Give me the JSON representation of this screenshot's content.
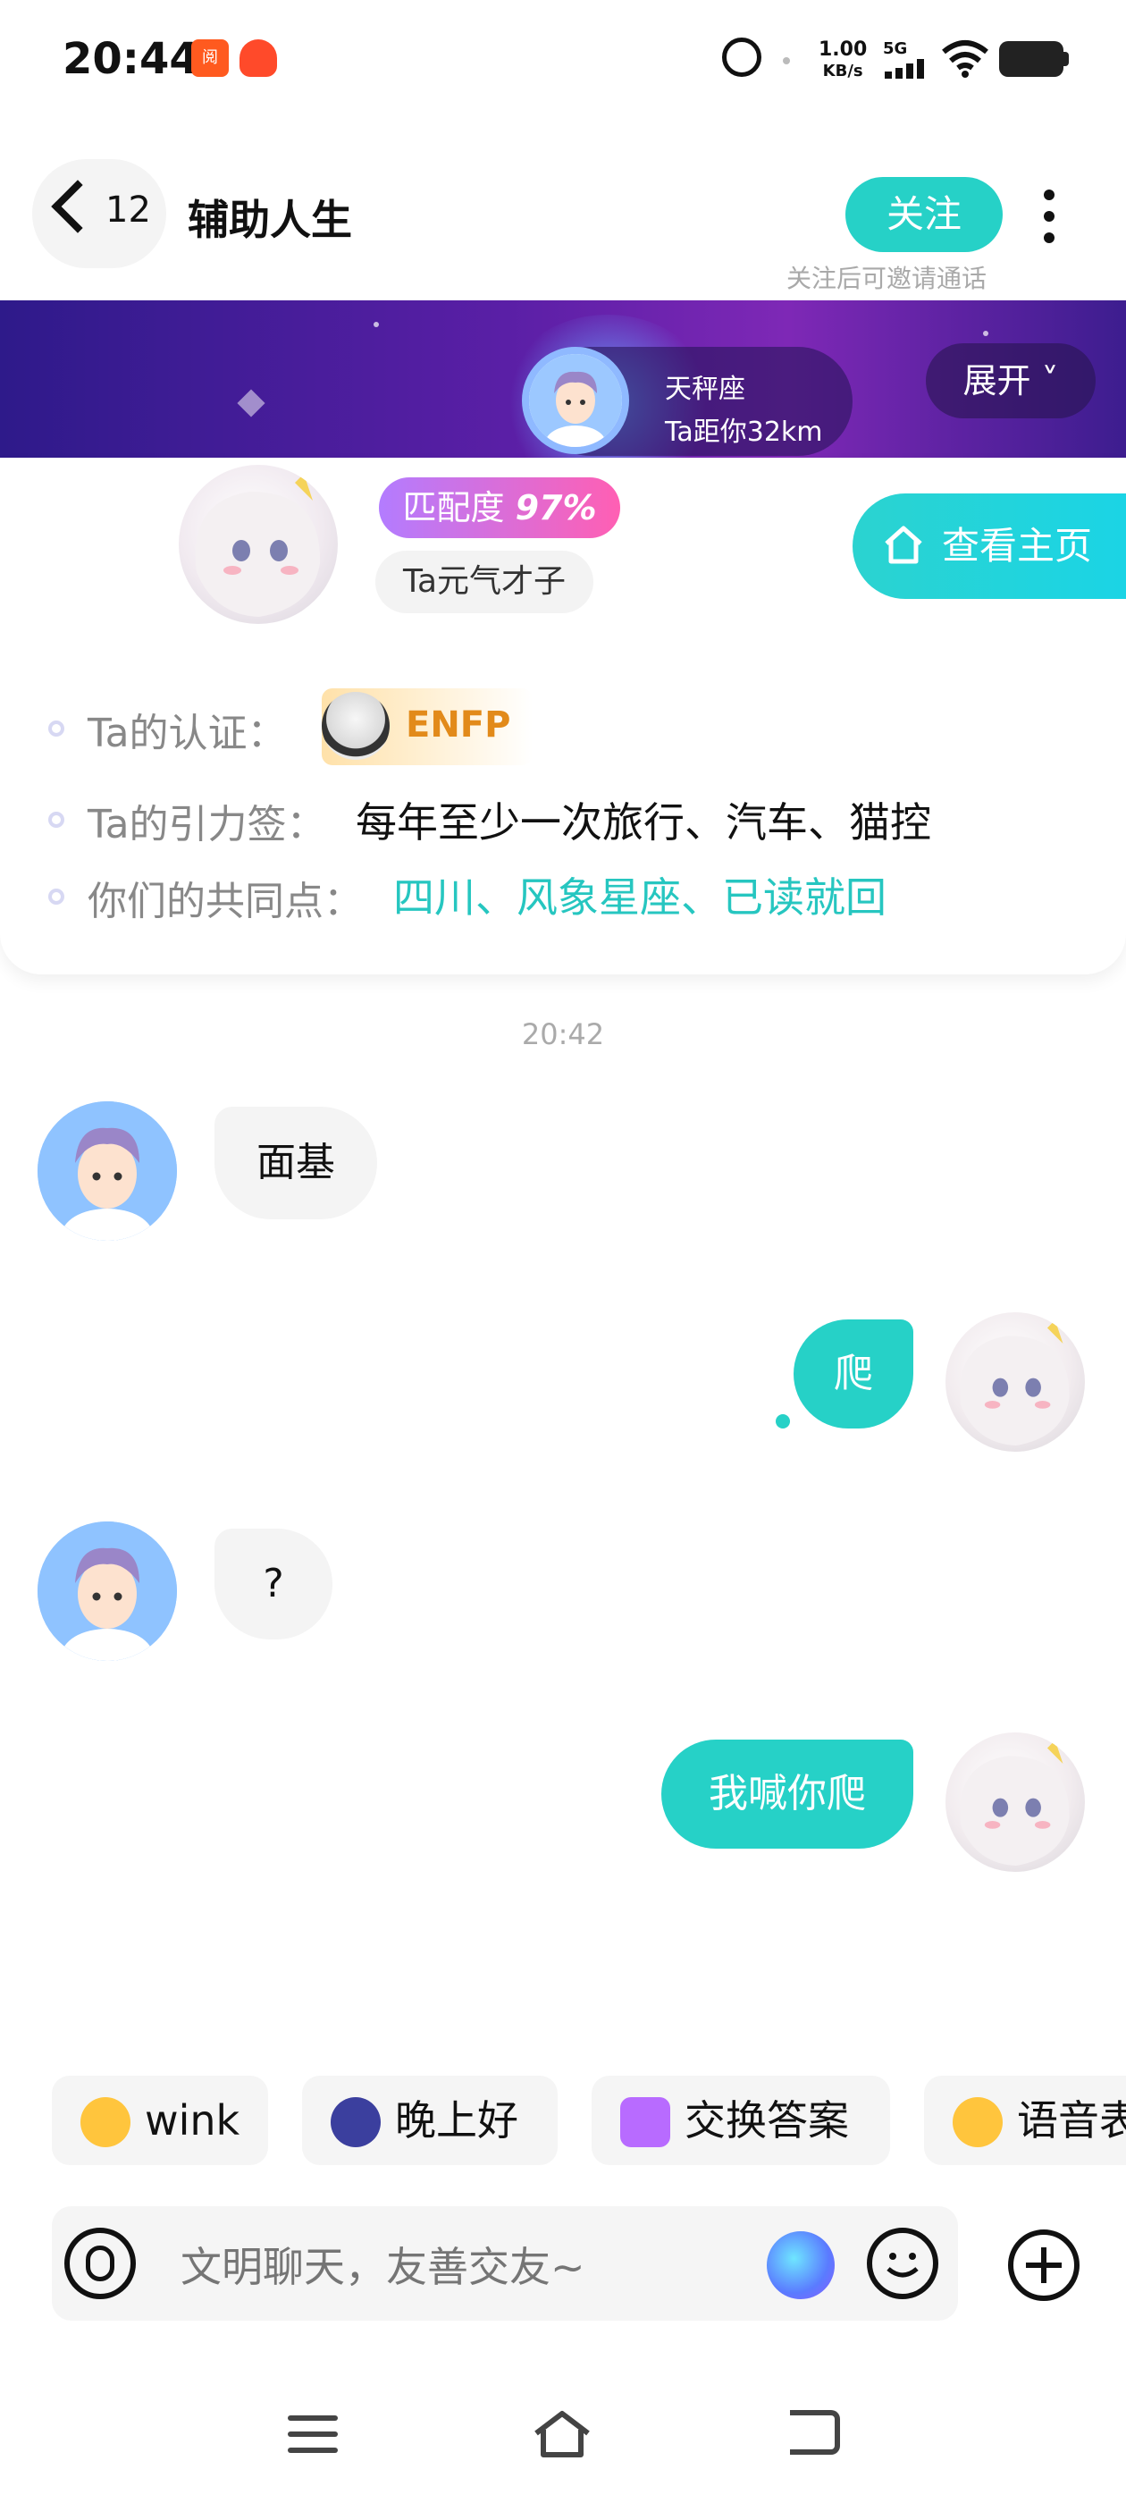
{
  "status_bar": {
    "time": "20:44",
    "net_speed_value": "1.00",
    "net_speed_unit": "KB/s",
    "network_type": "5G",
    "app_badge_1": "阅"
  },
  "header": {
    "back_count": "12",
    "title": "辅助人生",
    "follow_label": "关注",
    "follow_hint": "关注后可邀请通话"
  },
  "banner": {
    "zodiac": "天秤座",
    "distance": "Ta距你32km",
    "expand_label": "展开 ˅"
  },
  "profile": {
    "match_label": "匹配度",
    "match_value": "97%",
    "trait": "Ta元气才子",
    "homepage_label": "查看主页",
    "cert_label": "Ta的认证：",
    "mbti": "ENFP",
    "gravity_label": "Ta的引力签：",
    "gravity_tags": "每年至少一次旅行、汽车、猫控",
    "common_label": "你们的共同点：",
    "common_tags": "四川、风象星座、已读就回"
  },
  "chat": {
    "timestamp": "20:42",
    "messages": [
      {
        "from": "peer",
        "text": "面基"
      },
      {
        "from": "me",
        "text": "爬"
      },
      {
        "from": "peer",
        "text": "?"
      },
      {
        "from": "me",
        "text": "我喊你爬"
      }
    ]
  },
  "quick_replies": [
    {
      "label": "wink",
      "icon": "wink-emoji-icon"
    },
    {
      "label": "晚上好",
      "icon": "moon-icon"
    },
    {
      "label": "交换答案",
      "icon": "exchange-icon"
    },
    {
      "label": "语音表",
      "icon": "voice-emoji-icon"
    }
  ],
  "input": {
    "placeholder": "文明聊天，友善交友~"
  },
  "colors": {
    "accent": "#26d1c7",
    "match_gradient_start": "#b37cff",
    "match_gradient_end": "#ff5fb3",
    "mbti_text": "#e28a1a"
  }
}
